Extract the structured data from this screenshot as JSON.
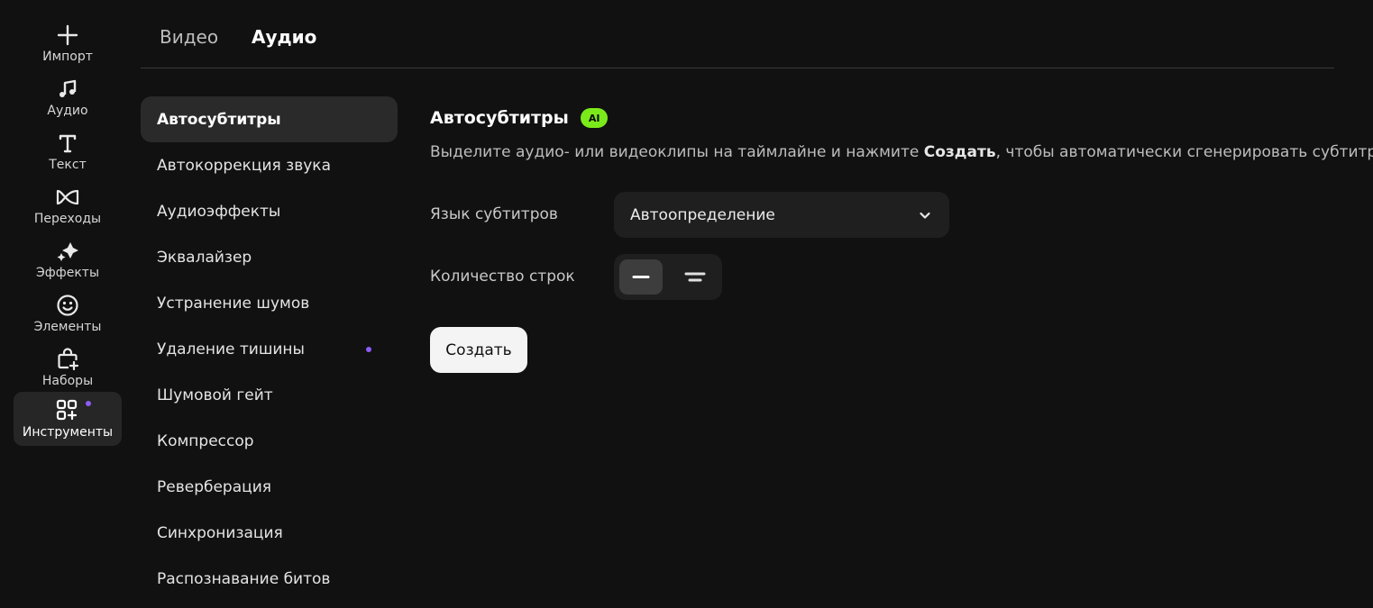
{
  "rail": {
    "items": [
      {
        "label": "Импорт",
        "icon": "plus-icon"
      },
      {
        "label": "Аудио",
        "icon": "music-note-icon"
      },
      {
        "label": "Текст",
        "icon": "text-icon"
      },
      {
        "label": "Переходы",
        "icon": "transition-icon"
      },
      {
        "label": "Эффекты",
        "icon": "sparkle-icon"
      },
      {
        "label": "Элементы",
        "icon": "smiley-icon"
      },
      {
        "label": "Наборы",
        "icon": "bag-plus-icon"
      },
      {
        "label": "Инструменты",
        "icon": "tools-grid-icon",
        "active": true,
        "badge": true
      }
    ]
  },
  "tabs": {
    "video": "Видео",
    "audio": "Аудио",
    "active": "audio"
  },
  "sublist": {
    "items": [
      {
        "label": "Автосубтитры",
        "active": true
      },
      {
        "label": "Автокоррекция звука"
      },
      {
        "label": "Аудиоэффекты"
      },
      {
        "label": "Эквалайзер"
      },
      {
        "label": "Устранение шумов"
      },
      {
        "label": "Удаление тишины",
        "badge": true
      },
      {
        "label": "Шумовой гейт"
      },
      {
        "label": "Компрессор"
      },
      {
        "label": "Реверберация"
      },
      {
        "label": "Синхронизация"
      },
      {
        "label": "Распознавание битов"
      }
    ]
  },
  "panel": {
    "title": "Автосубтитры",
    "ai_badge": "AI",
    "desc_before": "Выделите аудио- или видеоклипы на таймлайне и нажмите ",
    "desc_bold": "Создать",
    "desc_after": ", чтобы автоматически сгенерировать субтитры",
    "language_label": "Язык субтитров",
    "language_value": "Автоопределение",
    "lines_label": "Количество строк",
    "lines_selected": "single-line",
    "create_label": "Создать"
  },
  "colors": {
    "background": "#111111",
    "accent_green": "#7bea1b",
    "badge_purple": "#8b5cf6"
  }
}
